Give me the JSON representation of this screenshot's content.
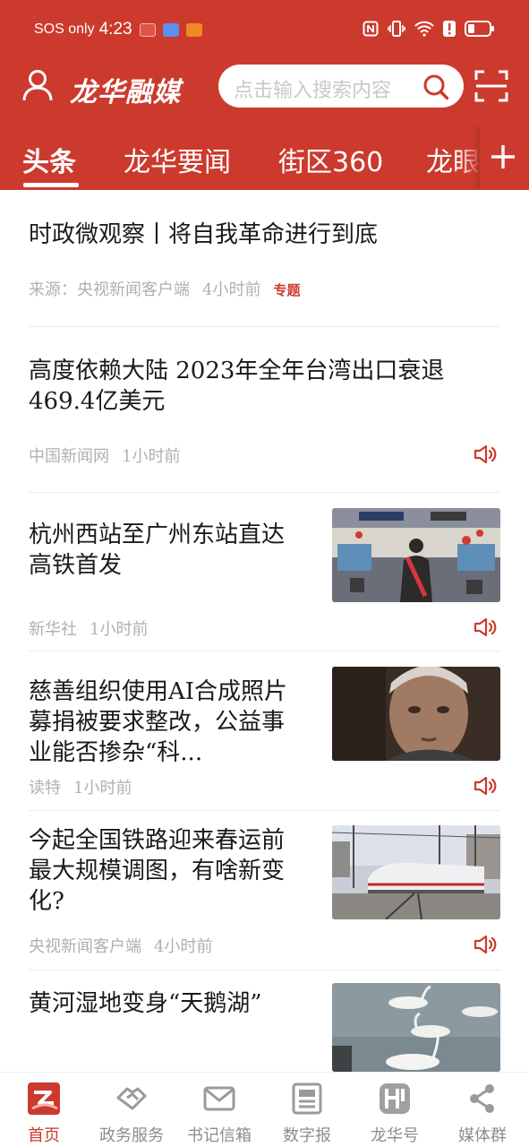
{
  "colors": {
    "brand_red": "#cc3a2d",
    "meta_gray": "#b0b0b0",
    "nav_gray": "#8d8d8d"
  },
  "status_bar": {
    "carrier": "SOS only",
    "time": "4:23",
    "icons": [
      "app-notification-icon",
      "app-notification-icon",
      "download-icon",
      "nfc-icon",
      "vibrate-icon",
      "wifi-icon",
      "alert-icon",
      "battery-icon"
    ]
  },
  "header": {
    "logo_text": "龙华融媒",
    "search": {
      "placeholder": "点击输入搜索内容"
    },
    "icons": {
      "user": "user-icon",
      "search": "search-icon",
      "scan": "scan-icon"
    }
  },
  "tabs": [
    {
      "label": "头条",
      "active": true
    },
    {
      "label": "龙华要闻",
      "active": false
    },
    {
      "label": "街区360",
      "active": false
    },
    {
      "label": "龙眼",
      "active": false
    }
  ],
  "feed": {
    "items": [
      {
        "title": "时政微观察丨将自我革命进行到底",
        "source": "来源：央视新闻客户端",
        "time": "4小时前",
        "tag": "专题",
        "has_image": false,
        "has_audio": false
      },
      {
        "title": "高度依赖大陆 2023年全年台湾出口衰退469.4亿美元",
        "source": "中国新闻网",
        "time": "1小时前",
        "has_image": false,
        "has_audio": true
      },
      {
        "title": "杭州西站至广州东站直达高铁首发",
        "source": "新华社",
        "time": "1小时前",
        "has_image": true,
        "image": "train-interior-photo",
        "has_audio": true
      },
      {
        "title": "慈善组织使用AI合成照片募捐被要求整改，公益事业能否掺杂“科...",
        "source": "读特",
        "time": "1小时前",
        "has_image": true,
        "image": "elderly-woman-portrait",
        "has_audio": true
      },
      {
        "title": "今起全国铁路迎来春运前最大规模调图，有啥新变化?",
        "source": "央视新闻客户端",
        "time": "4小时前",
        "has_image": true,
        "image": "high-speed-train-photo",
        "has_audio": true
      },
      {
        "title": "黄河湿地变身“天鹅湖”",
        "has_image": true,
        "image": "swans-lake-photo"
      }
    ]
  },
  "bottom_nav": [
    {
      "label": "首页",
      "icon": "home-logo-icon",
      "active": true
    },
    {
      "label": "政务服务",
      "icon": "handshake-icon",
      "active": false
    },
    {
      "label": "书记信箱",
      "icon": "mail-icon",
      "active": false
    },
    {
      "label": "数字报",
      "icon": "newspaper-icon",
      "active": false
    },
    {
      "label": "龙华号",
      "icon": "longhua-logo-icon",
      "active": false
    },
    {
      "label": "媒体群",
      "icon": "share-network-icon",
      "active": false
    }
  ]
}
